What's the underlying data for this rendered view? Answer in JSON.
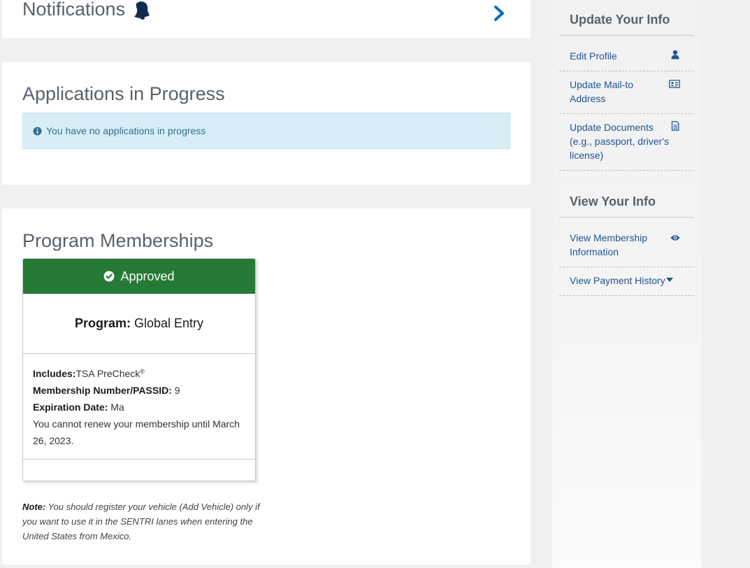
{
  "notifications": {
    "title": "Notifications"
  },
  "applications": {
    "title": "Applications in Progress",
    "info_message": "You have no applications in progress"
  },
  "memberships": {
    "title": "Program Memberships",
    "card": {
      "status": "Approved",
      "program_label": "Program:",
      "program_value": "Global Entry",
      "includes_label": "Includes:",
      "includes_value": "TSA PreCheck",
      "includes_mark": "®",
      "membership_label": "Membership Number/PASSID:",
      "membership_value": "9",
      "expiration_label": "Expiration Date:",
      "expiration_value": "Ma",
      "renew_message": "You cannot renew your membership until March 26, 2023."
    },
    "note_label": "Note:",
    "note_text": " You should register your vehicle (Add Vehicle) only if you want to use it in the SENTRI lanes when entering the United States from Mexico.",
    "colors": {
      "approved": "#247a36",
      "info_bg": "#d9edf7",
      "info_text": "#31708f"
    }
  },
  "sidebar": {
    "update_title": "Update Your Info",
    "update_items": [
      {
        "label": "Edit Profile",
        "icon": "user-icon"
      },
      {
        "label": "Update Mail-to Address",
        "icon": "id-card-icon"
      },
      {
        "label": "Update Documents (e.g., passport, driver's license)",
        "icon": "document-icon"
      }
    ],
    "view_title": "View Your Info",
    "view_items": [
      {
        "label": "View Membership Information",
        "icon": "eye-icon"
      },
      {
        "label": "View Payment History",
        "icon": "caret-down-icon"
      }
    ],
    "link_color": "#205493"
  }
}
